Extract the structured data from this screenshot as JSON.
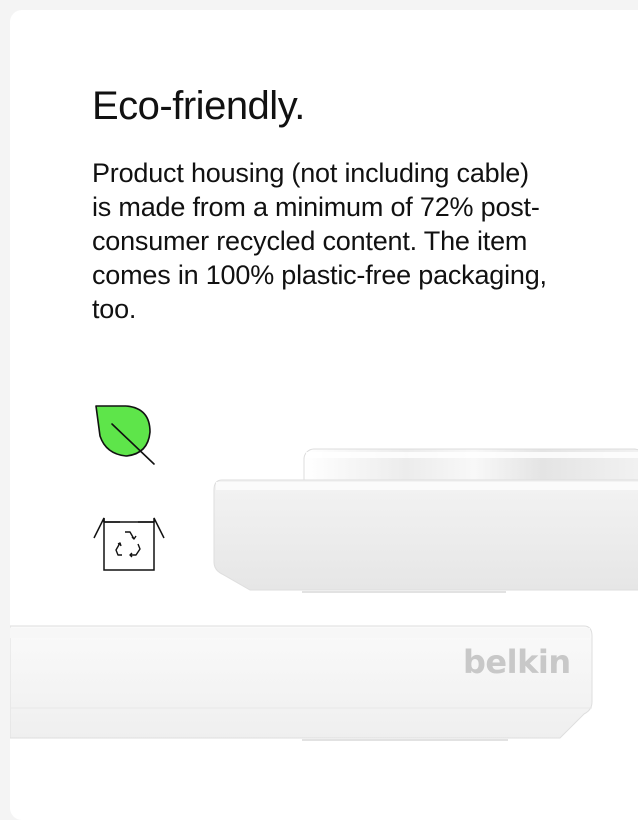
{
  "section": {
    "title": "Eco-friendly.",
    "body": "Product housing (not including cable) is made from a minimum of 72% post-consumer recycled content. The item comes in 100% plastic-free packaging, too."
  },
  "icons": {
    "leaf": "leaf-icon",
    "packaging": "recycle-box-icon"
  },
  "product": {
    "brand": "belkin"
  },
  "colors": {
    "leaf_green": "#5ee54a",
    "text": "#111111",
    "background": "#ffffff"
  }
}
